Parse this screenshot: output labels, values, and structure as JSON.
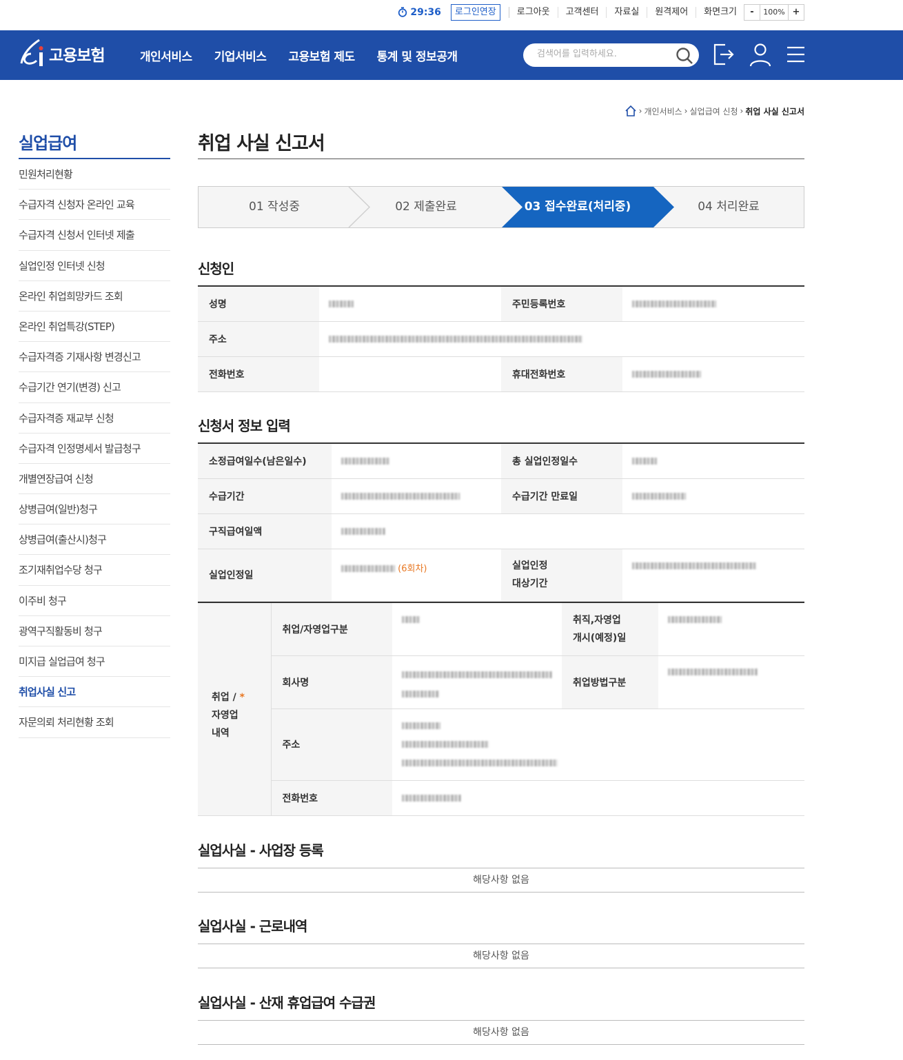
{
  "util": {
    "timer": "29:36",
    "extend": "로그인연장",
    "links": [
      "로그아웃",
      "고객센터",
      "자료실",
      "원격제어",
      "화면크기"
    ],
    "zoom_minus": "-",
    "zoom_value": "100%",
    "zoom_plus": "+"
  },
  "header": {
    "logo": "고용보험",
    "menu": [
      "개인서비스",
      "기업서비스",
      "고용보험 제도",
      "통계 및 정보공개"
    ],
    "search_placeholder": "검색어를 입력하세요."
  },
  "breadcrumb": [
    "개인서비스",
    "실업급여 신청",
    "취업 사실 신고서"
  ],
  "sidebar": {
    "title": "실업급여",
    "items": [
      "민원처리현황",
      "수급자격 신청자 온라인 교육",
      "수급자격 신청서 인터넷 제출",
      "실업인정 인터넷 신청",
      "온라인 취업희망카드 조회",
      "온라인 취업특강(STEP)",
      "수급자격증 기재사항 변경신고",
      "수급기간 연기(변경) 신고",
      "수급자격증 재교부 신청",
      "수급자격 인정명세서 발급청구",
      "개별연장급여 신청",
      "상병급여(일반)청구",
      "상병급여(출산시)청구",
      "조기재취업수당 청구",
      "이주비 청구",
      "광역구직활동비 청구",
      "미지급 실업급여 청구",
      "취업사실 신고",
      "자문의뢰 처리현황 조회"
    ],
    "active_index": 17
  },
  "page": {
    "title": "취업 사실 신고서",
    "steps": [
      "01 작성중",
      "02 제출완료",
      "03 접수완료(처리중)",
      "04 처리완료"
    ],
    "active_step": 2
  },
  "applicant": {
    "title": "신청인",
    "name_label": "성명",
    "rrn_label": "주민등록번호",
    "addr_label": "주소",
    "phone_label": "전화번호",
    "mobile_label": "휴대전화번호"
  },
  "application": {
    "title": "신청서 정보 입력",
    "days_label": "소정급여일수(남은일수)",
    "total_label": "총 실업인정일수",
    "period_label": "수급기간",
    "expire_label": "수급기간 만료일",
    "daily_label": "구직급여일액",
    "recog_label": "실업인정일",
    "recog_round": "(6회차)",
    "target_label_1": "실업인정",
    "target_label_2": "대상기간"
  },
  "employment": {
    "group_1": "취업 /",
    "group_2": "자영업",
    "group_3": "내역",
    "required": "*",
    "type_label": "취업/자영업구분",
    "start_label_1": "취직,자영업",
    "start_label_2": "개시(예정)일",
    "company_label": "회사명",
    "method_label": "취업방법구분",
    "addr_label": "주소",
    "phone_label": "전화번호"
  },
  "sections": [
    {
      "title": "실업사실 - 사업장 등록",
      "empty": "해당사항 없음"
    },
    {
      "title": "실업사실 - 근로내역",
      "empty": "해당사항 없음"
    },
    {
      "title": "실업사실 - 산재 휴업급여 수급권",
      "empty": "해당사항 없음"
    }
  ],
  "colors": {
    "brand": "#1f4ea8",
    "active_step": "#1565c0",
    "accent": "#e87722"
  }
}
